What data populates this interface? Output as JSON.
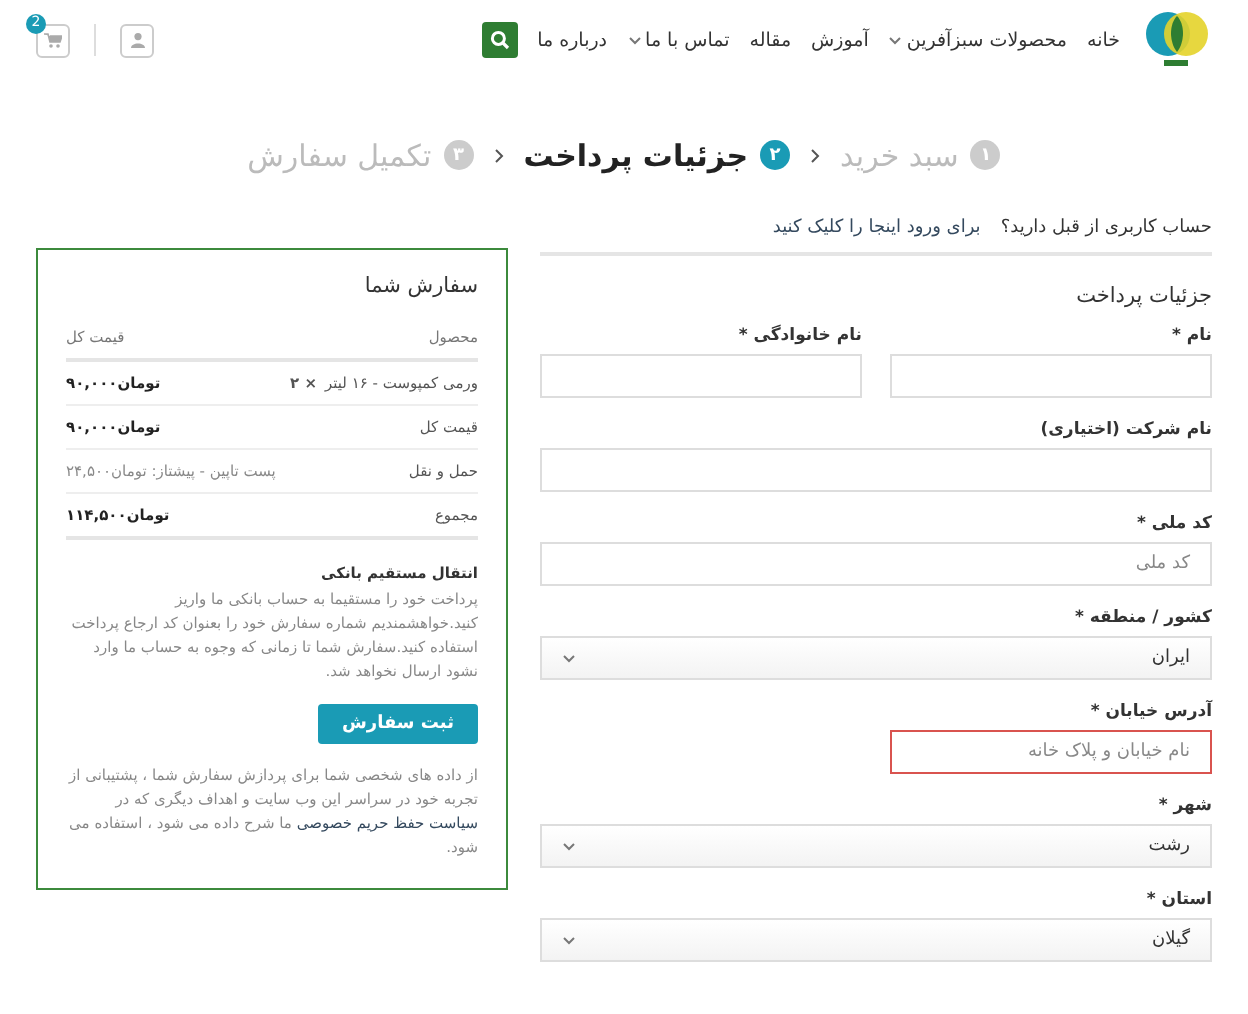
{
  "nav": {
    "menu": [
      {
        "label": "خانه",
        "has_dropdown": false
      },
      {
        "label": "محصولات سبزآفرین",
        "has_dropdown": true
      },
      {
        "label": "آموزش",
        "has_dropdown": false
      },
      {
        "label": "مقاله",
        "has_dropdown": false
      },
      {
        "label": "تماس با ما",
        "has_dropdown": true
      },
      {
        "label": "درباره ما",
        "has_dropdown": false
      }
    ],
    "cart_count": "2"
  },
  "steps": [
    {
      "number": "۱",
      "label": "سبد خرید",
      "selected": false
    },
    {
      "number": "۲",
      "label": "جزئیات پرداخت",
      "selected": true
    },
    {
      "number": "۳",
      "label": "تکمیل سفارش",
      "selected": false
    }
  ],
  "login": {
    "prompt": "حساب کاربری از قبل دارید؟",
    "link": "برای ورود اینجا را کلیک کنید"
  },
  "billing": {
    "title": "جزئیات پرداخت",
    "rows": [
      [
        {
          "label": "نام *",
          "kind": "text",
          "invalid": false
        },
        {
          "label": "نام خانوادگی *",
          "kind": "text",
          "invalid": false
        }
      ],
      [
        {
          "label": "نام شرکت (اختیاری)",
          "kind": "text",
          "invalid": false
        }
      ],
      [
        {
          "label": "کد ملی *",
          "kind": "text",
          "placeholder": "کد ملی",
          "invalid": false
        }
      ],
      [
        {
          "label": "کشور / منطقه *",
          "kind": "select",
          "value": "ایران",
          "invalid": false
        }
      ],
      [
        {
          "label": "آدرس خیابان *",
          "kind": "text",
          "placeholder": "نام خیابان و پلاک خانه",
          "invalid": true,
          "half": true
        }
      ],
      [
        {
          "label": "شهر *",
          "kind": "select",
          "value": "رشت",
          "invalid": false
        }
      ],
      [
        {
          "label": "استان *",
          "kind": "select",
          "value": "گیلان",
          "invalid": false
        }
      ]
    ]
  },
  "order": {
    "title": "سفارش شما",
    "columns": [
      "محصول",
      "قیمت کل"
    ],
    "rows": [
      {
        "label": "ورمی کمپوست - ۱۶ لیتر",
        "quantity": "× ۲",
        "value": "تومان۹۰,۰۰۰",
        "kind": "item"
      },
      {
        "label": "قیمت کل",
        "value": "تومان۹۰,۰۰۰",
        "kind": "total"
      },
      {
        "label": "حمل و نقل",
        "value": "پست تاپین - پیشتاز: تومان۲۴,۵۰۰",
        "kind": "shipping"
      },
      {
        "label": "مجموع",
        "value": "تومان۱۱۴,۵۰۰",
        "kind": "total"
      }
    ],
    "payment_title": "انتقال مستقیم بانکی",
    "payment_text": "پرداخت خود را مستقیما به حساب بانکی ما واریز کنید.خواهشمندیم شماره سفارش خود را بعنوان کد ارجاع پرداخت استفاده کنید.سفارش شما تا زمانی که وجوه به حساب ما وارد نشود ارسال نخواهد شد.",
    "button": "ثبت سفارش",
    "privacy_before": "از داده های شخصی شما برای پردازش سفارش شما ، پشتیبانی از تجربه خود در سراسر این وب سایت و اهداف دیگری که در",
    "privacy_link": "سیاست حفظ حریم خصوصی",
    "privacy_after": "ما شرح داده می شود ، استفاده می شود."
  }
}
